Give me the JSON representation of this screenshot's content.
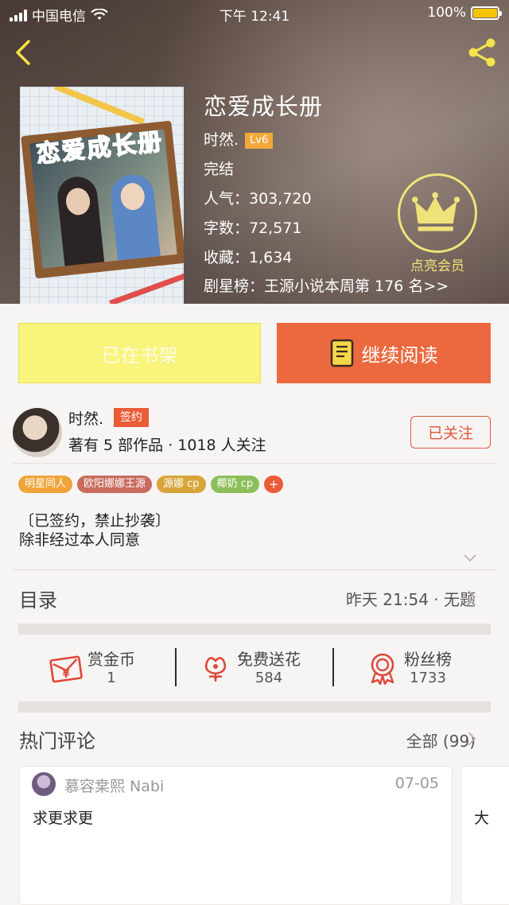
{
  "status_bar": {
    "carrier": "中国电信",
    "time": "下午 12:41",
    "battery": "100%"
  },
  "book": {
    "title": "恋爱成长册",
    "cover_title": "恋爱成长册",
    "author": "时然.",
    "author_level": "Lv6",
    "status": "完结",
    "popularity": "人气：303,720",
    "word_count": "字数：72,571",
    "favorites": "收藏：1,634",
    "ranking": "剧星榜：王源小说本周第 176 名>>"
  },
  "member": {
    "label": "点亮会员"
  },
  "actions": {
    "on_shelf": "已在书架",
    "continue_reading": "继续阅读"
  },
  "author_section": {
    "name": "时然.",
    "badge": "签约",
    "stats": "著有 5 部作品 · 1018 人关注",
    "follow_label": "已关注"
  },
  "tags": [
    {
      "label": "明星同人",
      "color": "#f0a43a"
    },
    {
      "label": "欧阳娜娜王源",
      "color": "#c96b5e"
    },
    {
      "label": "源娜 cp",
      "color": "#d8a53a"
    },
    {
      "label": "椰奶 cp",
      "color": "#8cbf5b"
    }
  ],
  "tag_add": "+",
  "description": {
    "line1": "〔已签约，禁止抄袭〕",
    "line2": "除非经过本人同意"
  },
  "toc": {
    "title": "目录",
    "latest": "昨天 21:54 · 无题"
  },
  "rewards": [
    {
      "label": "赏金币",
      "count": "1",
      "icon": "red-envelope-icon"
    },
    {
      "label": "免费送花",
      "count": "584",
      "icon": "flower-icon"
    },
    {
      "label": "粉丝榜",
      "count": "1733",
      "icon": "medal-icon"
    }
  ],
  "comments": {
    "title": "热门评论",
    "all_label": "全部 (99)",
    "items": [
      {
        "user": "慕容枽熙 Nabi",
        "date": "07-05",
        "text": "求更求更"
      },
      {
        "text": "大"
      }
    ]
  },
  "colors": {
    "accent": "#ec683e",
    "shelf_button": "#f9f47c",
    "member_gold": "#f0e27a"
  }
}
